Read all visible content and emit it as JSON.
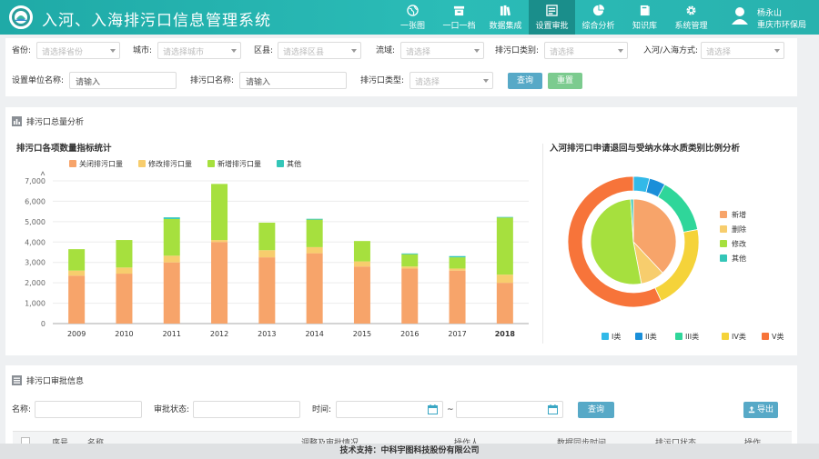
{
  "app": {
    "title": "入河、入海排污口信息管理系统"
  },
  "nav": {
    "items": [
      {
        "label": "一张图",
        "icon": "globe-icon",
        "active": false
      },
      {
        "label": "一口一档",
        "icon": "archive-icon",
        "active": false
      },
      {
        "label": "数据集成",
        "icon": "books-icon",
        "active": false
      },
      {
        "label": "设置审批",
        "icon": "form-icon",
        "active": true
      },
      {
        "label": "综合分析",
        "icon": "pie-chart-icon",
        "active": false
      },
      {
        "label": "知识库",
        "icon": "book-icon",
        "active": false
      },
      {
        "label": "系统管理",
        "icon": "gear-icon",
        "active": false
      }
    ]
  },
  "user": {
    "name": "杨永山",
    "org": "重庆市环保局"
  },
  "filters": {
    "province": {
      "label": "省份:",
      "placeholder": "请选择省份"
    },
    "city": {
      "label": "城市:",
      "placeholder": "请选择城市"
    },
    "county": {
      "label": "区县:",
      "placeholder": "请选择区县"
    },
    "basin": {
      "label": "流域:",
      "placeholder": "请选择"
    },
    "outlet_category": {
      "label": "排污口类别:",
      "placeholder": "请选择"
    },
    "entry_mode": {
      "label": "入河/入海方式:",
      "placeholder": "请选择"
    },
    "unit_name": {
      "label": "设置单位名称:",
      "placeholder": "请输入"
    },
    "outlet_name": {
      "label": "排污口名称:",
      "placeholder": "请输入"
    },
    "outlet_type": {
      "label": "排污口类型:",
      "placeholder": "请选择"
    },
    "query_label": "查询",
    "reset_label": "重置"
  },
  "analysis": {
    "section_title": "排污口总量分析",
    "bar_title": "排污口各项数量指标统计",
    "donut_title": "入河排污口申请退回与受纳水体水质类别比例分析"
  },
  "chart_data": [
    {
      "type": "bar",
      "stacked": true,
      "title": "排污口各项数量指标统计",
      "categories": [
        "2009",
        "2010",
        "2011",
        "2012",
        "2013",
        "2014",
        "2015",
        "2016",
        "2017",
        "2018"
      ],
      "y_ticks": [
        "0",
        "1,000",
        "2,000",
        "3,000",
        "4,000",
        "5,000",
        "6,000",
        "7,000"
      ],
      "ylim": [
        0,
        7000
      ],
      "grid": true,
      "legend": "top-center",
      "series": [
        {
          "name": "关闭排污口量",
          "color": "#f7a46a",
          "values": [
            2350,
            2450,
            3000,
            4000,
            3250,
            3450,
            2800,
            2700,
            2600,
            2000
          ]
        },
        {
          "name": "修改排污口量",
          "color": "#f7cd6d",
          "values": [
            250,
            300,
            330,
            100,
            350,
            300,
            250,
            100,
            100,
            400
          ]
        },
        {
          "name": "新增排污口量",
          "color": "#a6e03e",
          "values": [
            1050,
            1350,
            1800,
            2750,
            1350,
            1350,
            1000,
            600,
            550,
            2800
          ]
        },
        {
          "name": "其他",
          "color": "#34c6b8",
          "values": [
            0,
            0,
            80,
            0,
            0,
            40,
            0,
            40,
            60,
            30
          ]
        }
      ]
    },
    {
      "type": "pie",
      "title": "入河排污口申请退回与受纳水体水质类别比例分析",
      "donut": true,
      "legend": "right / bottom",
      "inner": {
        "labels": [
          "新增",
          "删除",
          "修改",
          "其他"
        ],
        "colors": [
          "#f7a46a",
          "#f7cd6d",
          "#a6e03e",
          "#34c6b8"
        ],
        "values": [
          38,
          9,
          52,
          1
        ]
      },
      "outer": {
        "labels": [
          "I类",
          "II类",
          "III类",
          "IV类",
          "V类"
        ],
        "colors": [
          "#32b9e8",
          "#1a8fd9",
          "#2fd69a",
          "#f5d33a",
          "#f7743a"
        ],
        "values": [
          4,
          4,
          14,
          21,
          57
        ]
      }
    }
  ],
  "approval": {
    "section_title": "排污口审批信息",
    "name_label": "名称:",
    "status_label": "审批状态:",
    "time_label": "时间:",
    "range_sep": "~",
    "query_label": "查询",
    "export_label": "导出",
    "columns": [
      "序号",
      "名称",
      "调整及审批情况",
      "操作人",
      "数据同步时间",
      "排污口状态",
      "操作"
    ]
  },
  "footer": {
    "text": "技术支持：中科宇图科技股份有限公司"
  }
}
